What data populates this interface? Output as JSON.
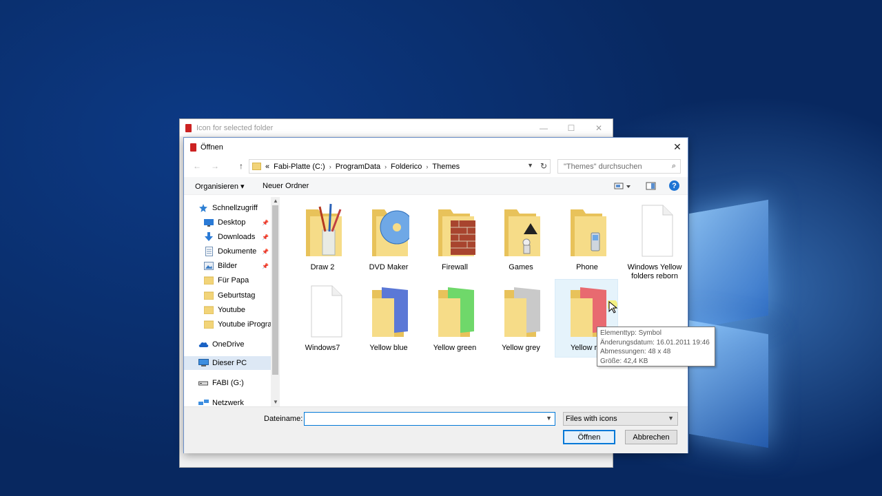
{
  "background_window": {
    "title": "Icon for selected folder",
    "minimize": "—",
    "maximize": "☐",
    "close": "✕"
  },
  "dialog": {
    "title": "Öffnen",
    "close": "✕",
    "nav": {
      "back": "←",
      "forward": "→",
      "up": "↑"
    },
    "breadcrumb": {
      "overflow": "«",
      "items": [
        "Fabi-Platte (C:)",
        "ProgramData",
        "Folderico",
        "Themes"
      ]
    },
    "search": {
      "placeholder": "\"Themes\" durchsuchen"
    },
    "commands": {
      "organize": "Organisieren ▾",
      "new_folder": "Neuer Ordner",
      "help": "?"
    },
    "sidebar": {
      "items": [
        {
          "label": "Schnellzugriff",
          "icon": "star-icon",
          "pinned": false
        },
        {
          "label": "Desktop",
          "icon": "desktop-icon",
          "pinned": true
        },
        {
          "label": "Downloads",
          "icon": "download-icon",
          "pinned": true
        },
        {
          "label": "Dokumente",
          "icon": "document-icon",
          "pinned": true
        },
        {
          "label": "Bilder",
          "icon": "pictures-icon",
          "pinned": true
        },
        {
          "label": "Für Papa",
          "icon": "folder-icon",
          "pinned": false
        },
        {
          "label": "Geburtstag",
          "icon": "folder-icon",
          "pinned": false
        },
        {
          "label": "Youtube",
          "icon": "folder-icon",
          "pinned": false
        },
        {
          "label": "Youtube iProgra",
          "icon": "folder-icon",
          "pinned": false
        },
        {
          "label": "OneDrive",
          "icon": "cloud-icon",
          "pinned": false
        },
        {
          "label": "Dieser PC",
          "icon": "computer-icon",
          "pinned": false,
          "selected": true
        },
        {
          "label": "FABI (G:)",
          "icon": "drive-icon",
          "pinned": false
        },
        {
          "label": "Netzwerk",
          "icon": "network-icon",
          "pinned": false
        }
      ]
    },
    "files": [
      {
        "name": "Draw 2",
        "icon": "folder-draw-icon"
      },
      {
        "name": "DVD Maker",
        "icon": "folder-dvd-icon"
      },
      {
        "name": "Firewall",
        "icon": "folder-firewall-icon"
      },
      {
        "name": "Games",
        "icon": "folder-games-icon"
      },
      {
        "name": "Phone",
        "icon": "folder-phone-icon"
      },
      {
        "name": "Windows Yellow folders reborn",
        "icon": "blank-file-icon"
      },
      {
        "name": "Windows7",
        "icon": "blank-file-icon"
      },
      {
        "name": "Yellow blue",
        "icon": "folder-blue-icon"
      },
      {
        "name": "Yellow green",
        "icon": "folder-green-icon"
      },
      {
        "name": "Yellow grey",
        "icon": "folder-grey-icon"
      },
      {
        "name": "Yellow r",
        "icon": "folder-red-icon",
        "hovered": true
      }
    ],
    "tooltip": {
      "type": "Elementtyp: Symbol",
      "modified": "Änderungsdatum: 16.01.2011 19:46",
      "dimensions": "Abmessungen: 48 x 48",
      "size": "Größe: 42,4 KB"
    },
    "filename_label": "Dateiname:",
    "filename_value": "",
    "filter": "Files with icons",
    "open_button": "Öffnen",
    "cancel_button": "Abbrechen"
  },
  "colors": {
    "accent": "#0078d7",
    "desktop": "#0a2f6e",
    "folder": "#f2d479"
  }
}
